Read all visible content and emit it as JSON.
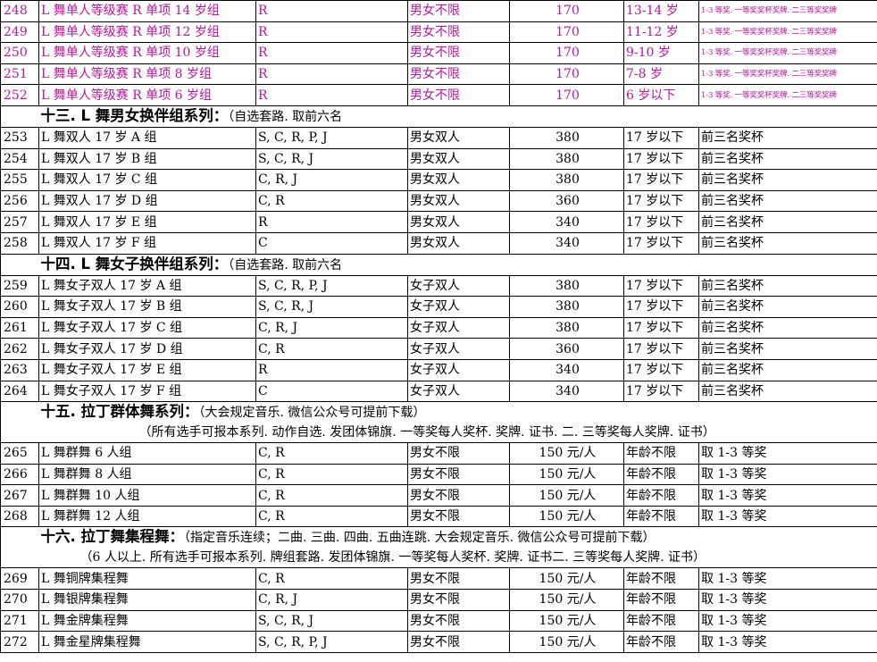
{
  "rows_248": [
    {
      "no": "248",
      "name": "L 舞单人等级赛 R 单项 14 岁组",
      "dances": "R",
      "gender": "男女不限",
      "fee": "170",
      "age": "13-14 岁",
      "prize": "1-3 等奖. 一等奖奖杯奖牌. 二三等奖奖牌"
    },
    {
      "no": "249",
      "name": "L 舞单人等级赛 R 单项 12 岁组",
      "dances": "R",
      "gender": "男女不限",
      "fee": "170",
      "age": "11-12 岁",
      "prize": "1-3 等奖. 一等奖奖杯奖牌. 二三等奖奖牌"
    },
    {
      "no": "250",
      "name": "L 舞单人等级赛 R 单项 10 岁组",
      "dances": "R",
      "gender": "男女不限",
      "fee": "170",
      "age": "9-10 岁",
      "prize": "1-3 等奖. 一等奖奖杯奖牌. 二三等奖奖牌"
    },
    {
      "no": "251",
      "name": "L 舞单人等级赛 R 单项 8 岁组",
      "dances": "R",
      "gender": "男女不限",
      "fee": "170",
      "age": "7-8 岁",
      "prize": "1-3 等奖. 一等奖奖杯奖牌. 二三等奖奖牌"
    },
    {
      "no": "252",
      "name": "L 舞单人等级赛 R 单项 6 岁组",
      "dances": "R",
      "gender": "男女不限",
      "fee": "170",
      "age": "6 岁以下",
      "prize": "1-3 等奖. 一等奖奖杯奖牌. 二三等奖奖牌"
    }
  ],
  "sec13": {
    "title": "十三. L 舞男女换伴组系列：",
    "note": "（自选套路. 取前六名"
  },
  "rows_253": [
    {
      "no": "253",
      "name": "L 舞双人 17 岁 A 组",
      "dances": "S, C, R, P, J",
      "gender": "男女双人",
      "fee": "380",
      "age": "17 岁以下",
      "prize": "前三名奖杯"
    },
    {
      "no": "254",
      "name": "L 舞双人 17 岁 B 组",
      "dances": "S, C, R, J",
      "gender": "男女双人",
      "fee": "380",
      "age": "17 岁以下",
      "prize": "前三名奖杯"
    },
    {
      "no": "255",
      "name": "L 舞双人 17 岁 C 组",
      "dances": "C, R, J",
      "gender": "男女双人",
      "fee": "380",
      "age": "17 岁以下",
      "prize": "前三名奖杯"
    },
    {
      "no": "256",
      "name": "L 舞双人 17 岁 D 组",
      "dances": "C, R",
      "gender": "男女双人",
      "fee": "360",
      "age": "17 岁以下",
      "prize": "前三名奖杯"
    },
    {
      "no": "257",
      "name": "L 舞双人 17 岁 E 组",
      "dances": "R",
      "gender": "男女双人",
      "fee": "340",
      "age": "17 岁以下",
      "prize": "前三名奖杯"
    },
    {
      "no": "258",
      "name": "L 舞双人 17 岁 F 组",
      "dances": "C",
      "gender": "男女双人",
      "fee": "340",
      "age": "17 岁以下",
      "prize": "前三名奖杯"
    }
  ],
  "sec14": {
    "title": "十四. L 舞女子换伴组系列：",
    "note": "（自选套路. 取前六名"
  },
  "rows_259": [
    {
      "no": "259",
      "name": "L 舞女子双人 17 岁 A 组",
      "dances": "S, C, R, P, J",
      "gender": "女子双人",
      "fee": "380",
      "age": "17 岁以下",
      "prize": "前三名奖杯"
    },
    {
      "no": "260",
      "name": "L 舞女子双人 17 岁 B 组",
      "dances": "S, C, R, J",
      "gender": "女子双人",
      "fee": "380",
      "age": "17 岁以下",
      "prize": "前三名奖杯"
    },
    {
      "no": "261",
      "name": "L 舞女子双人 17 岁 C 组",
      "dances": "C, R, J",
      "gender": "女子双人",
      "fee": "380",
      "age": "17 岁以下",
      "prize": "前三名奖杯"
    },
    {
      "no": "262",
      "name": "L 舞女子双人 17 岁 D 组",
      "dances": "C, R",
      "gender": "女子双人",
      "fee": "360",
      "age": "17 岁以下",
      "prize": "前三名奖杯"
    },
    {
      "no": "263",
      "name": "L 舞女子双人 17 岁 E 组",
      "dances": "R",
      "gender": "女子双人",
      "fee": "340",
      "age": "17 岁以下",
      "prize": "前三名奖杯"
    },
    {
      "no": "264",
      "name": "L 舞女子双人 17 岁 F 组",
      "dances": "C",
      "gender": "女子双人",
      "fee": "340",
      "age": "17 岁以下",
      "prize": "前三名奖杯"
    }
  ],
  "sec15": {
    "title": "十五. 拉丁群体舞系列：",
    "note": "（大会规定音乐. 微信公众号可提前下载）",
    "line2": "（所有选手可报本系列. 动作自选. 发团体锦旗. 一等奖每人奖杯. 奖牌. 证书. 二. 三等奖每人奖牌. 证书）"
  },
  "rows_265": [
    {
      "no": "265",
      "name": "L 舞群舞 6 人组",
      "dances": "C, R",
      "gender": "男女不限",
      "fee": "150 元/人",
      "age": "年龄不限",
      "prize": "取 1-3 等奖"
    },
    {
      "no": "266",
      "name": "L 舞群舞 8 人组",
      "dances": "C, R",
      "gender": "男女不限",
      "fee": "150 元/人",
      "age": "年龄不限",
      "prize": "取 1-3 等奖"
    },
    {
      "no": "267",
      "name": "L 舞群舞 10 人组",
      "dances": "C, R",
      "gender": "男女不限",
      "fee": "150 元/人",
      "age": "年龄不限",
      "prize": "取 1-3 等奖"
    },
    {
      "no": "268",
      "name": "L 舞群舞 12 人组",
      "dances": "C, R",
      "gender": "男女不限",
      "fee": "150 元/人",
      "age": "年龄不限",
      "prize": "取 1-3 等奖"
    }
  ],
  "sec16": {
    "title": "十六. 拉丁舞集程舞：",
    "note": "（指定音乐连续；二曲. 三曲. 四曲. 五曲连跳. 大会规定音乐. 微信公众号可提前下载）",
    "line2": "（6 人以上. 所有选手可报本系列. 牌组套路. 发团体锦旗. 一等奖每人奖杯. 奖牌. 证书二. 三等奖每人奖牌. 证书）"
  },
  "rows_269": [
    {
      "no": "269",
      "name": "L 舞铜牌集程舞",
      "dances": "C, R",
      "gender": "男女不限",
      "fee": "150 元/人",
      "age": "年龄不限",
      "prize": "取 1-3 等奖"
    },
    {
      "no": "270",
      "name": "L 舞银牌集程舞",
      "dances": "C, R, J",
      "gender": "男女不限",
      "fee": "150 元/人",
      "age": "年龄不限",
      "prize": "取 1-3 等奖"
    },
    {
      "no": "271",
      "name": "L 舞金牌集程舞",
      "dances": "S, C, R, J",
      "gender": "男女不限",
      "fee": "150 元/人",
      "age": "年龄不限",
      "prize": "取 1-3 等奖"
    },
    {
      "no": "272",
      "name": "L 舞金星牌集程舞",
      "dances": "S, C, R, P, J",
      "gender": "男女不限",
      "fee": "150 元/人",
      "age": "年龄不限",
      "prize": "取 1-3 等奖"
    }
  ]
}
